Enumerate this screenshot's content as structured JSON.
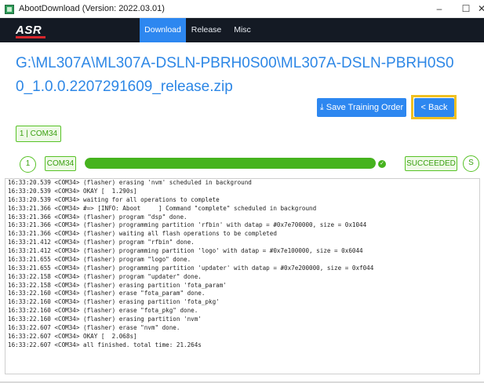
{
  "window": {
    "title": "AbootDownload (Version: 2022.03.01)",
    "minimize": "–",
    "maximize": "☐",
    "close": "✕"
  },
  "nav": {
    "logo": "ASR",
    "tabs": [
      {
        "label": "Download",
        "active": true
      },
      {
        "label": "Release",
        "active": false
      },
      {
        "label": "Misc",
        "active": false
      }
    ]
  },
  "main": {
    "file_path": "G:\\ML307A\\ML307A-DSLN-PBRH0S00\\ML307A-DSLN-PBRH0S00_1.0.0.2207291609_release.zip",
    "save_training_order": "⤓ Save Training Order",
    "back": "< Back",
    "device_tag": "1 | COM34"
  },
  "progress": {
    "index": "1",
    "port": "COM34",
    "percent": 100,
    "check": "✓",
    "status": "SUCCEEDED",
    "status_circle": "S",
    "fill_color": "#46b31e"
  },
  "log": {
    "lines": [
      "16:33:20.539 <COM34> (flasher) erasing 'nvm' scheduled in background",
      "16:33:20.539 <COM34> OKAY [  1.290s]",
      "16:33:20.539 <COM34> waiting for all operations to complete",
      "16:33:21.366 <COM34> #=> [INFO: Aboot     ] Command \"complete\" scheduled in background",
      "16:33:21.366 <COM34> (flasher) program \"dsp\" done.",
      "16:33:21.366 <COM34> (flasher) programming partition 'rfbin' with datap = #0x7e700000, size = 0x1044",
      "16:33:21.366 <COM34> (flasher) waiting all flash operations to be completed",
      "16:33:21.412 <COM34> (flasher) program \"rfbin\" done.",
      "16:33:21.412 <COM34> (flasher) programming partition 'logo' with datap = #0x7e100000, size = 0x6044",
      "16:33:21.655 <COM34> (flasher) program \"logo\" done.",
      "16:33:21.655 <COM34> (flasher) programming partition 'updater' with datap = #0x7e200000, size = 0xf044",
      "16:33:22.158 <COM34> (flasher) program \"updater\" done.",
      "16:33:22.158 <COM34> (flasher) erasing partition 'fota_param'",
      "16:33:22.160 <COM34> (flasher) erase \"fota_param\" done.",
      "16:33:22.160 <COM34> (flasher) erasing partition 'fota_pkg'",
      "16:33:22.160 <COM34> (flasher) erase \"fota_pkg\" done.",
      "16:33:22.160 <COM34> (flasher) erasing partition 'nvm'",
      "16:33:22.607 <COM34> (flasher) erase \"nvm\" done.",
      "16:33:22.607 <COM34> OKAY [  2.068s]",
      "16:33:22.607 <COM34> all finished. total time: 21.264s"
    ]
  }
}
